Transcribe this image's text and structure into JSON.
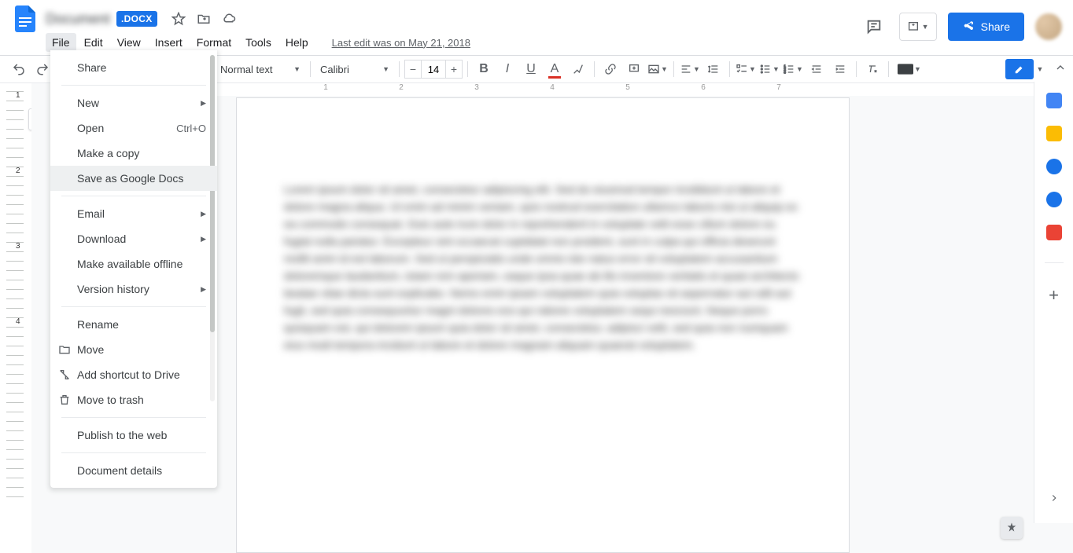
{
  "doc": {
    "title": "Document",
    "badge": ".DOCX",
    "edit_info": "Last edit was on May 21, 2018"
  },
  "menubar": {
    "items": [
      "File",
      "Edit",
      "View",
      "Insert",
      "Format",
      "Tools",
      "Help"
    ]
  },
  "header": {
    "share": "Share"
  },
  "toolbar": {
    "style": "Normal text",
    "font": "Calibri",
    "size": "14"
  },
  "ruler": {
    "h": [
      "1",
      "2",
      "3",
      "4",
      "5",
      "6",
      "7"
    ],
    "v": [
      "1",
      "2",
      "3",
      "4"
    ]
  },
  "filemenu": {
    "items": [
      {
        "label": "Share"
      },
      {
        "sep": true
      },
      {
        "label": "New",
        "sub": true
      },
      {
        "label": "Open",
        "shortcut": "Ctrl+O"
      },
      {
        "label": "Make a copy"
      },
      {
        "label": "Save as Google Docs",
        "hover": true
      },
      {
        "sep": true
      },
      {
        "label": "Email",
        "sub": true
      },
      {
        "label": "Download",
        "sub": true
      },
      {
        "label": "Make available offline"
      },
      {
        "label": "Version history",
        "sub": true
      },
      {
        "sep": true
      },
      {
        "label": "Rename"
      },
      {
        "label": "Move",
        "icon": "folder"
      },
      {
        "label": "Add shortcut to Drive",
        "icon": "shortcut"
      },
      {
        "label": "Move to trash",
        "icon": "trash"
      },
      {
        "sep": true
      },
      {
        "label": "Publish to the web"
      },
      {
        "sep": true
      },
      {
        "label": "Document details"
      }
    ]
  },
  "body": "Lorem ipsum dolor sit amet, consectetur adipiscing elit. Sed do eiusmod tempor incididunt ut labore et dolore magna aliqua. Ut enim ad minim veniam, quis nostrud exercitation ullamco laboris nisi ut aliquip ex ea commodo consequat. Duis aute irure dolor in reprehenderit in voluptate velit esse cillum dolore eu fugiat nulla pariatur. Excepteur sint occaecat cupidatat non proident, sunt in culpa qui officia deserunt mollit anim id est laborum. Sed ut perspiciatis unde omnis iste natus error sit voluptatem accusantium doloremque laudantium, totam rem aperiam, eaque ipsa quae ab illo inventore veritatis et quasi architecto beatae vitae dicta sunt explicabo. Nemo enim ipsam voluptatem quia voluptas sit aspernatur aut odit aut fugit, sed quia consequuntur magni dolores eos qui ratione voluptatem sequi nesciunt. Neque porro quisquam est, qui dolorem ipsum quia dolor sit amet, consectetur, adipisci velit, sed quia non numquam eius modi tempora incidunt ut labore et dolore magnam aliquam quaerat voluptatem."
}
